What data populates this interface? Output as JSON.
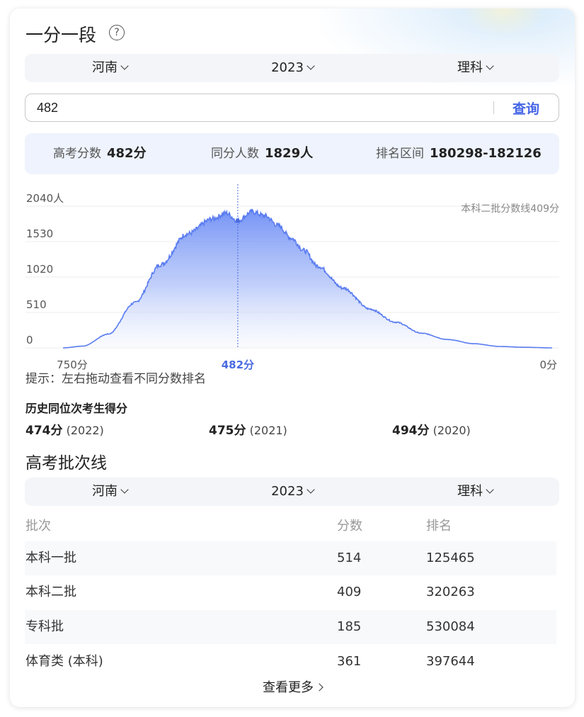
{
  "title": "一分一段",
  "help_icon": "question-circle-icon",
  "filters": {
    "province": "河南",
    "year": "2023",
    "subject": "理科"
  },
  "search": {
    "value": "482",
    "button_label": "查询"
  },
  "stats": {
    "score_label": "高考分数",
    "score_value": "482分",
    "same_label": "同分人数",
    "same_value": "1829人",
    "rank_label": "排名区间",
    "rank_value": "180298-182126"
  },
  "chart_data": {
    "type": "area",
    "y_ticks": [
      "2040人",
      "1530",
      "1020",
      "510",
      "0"
    ],
    "y_values": [
      2040,
      1530,
      1020,
      510,
      0
    ],
    "x_range": [
      750,
      0
    ],
    "x_left_label": "750分",
    "x_right_label": "0分",
    "selected_score": 482,
    "selected_label": "482分",
    "annotation": "本科二批分数线409分",
    "series_anchor_points": [
      [
        750,
        0
      ],
      [
        720,
        25
      ],
      [
        680,
        200
      ],
      [
        640,
        650
      ],
      [
        600,
        1200
      ],
      [
        560,
        1640
      ],
      [
        520,
        1860
      ],
      [
        500,
        1940
      ],
      [
        482,
        1829
      ],
      [
        460,
        1960
      ],
      [
        440,
        1900
      ],
      [
        420,
        1760
      ],
      [
        400,
        1580
      ],
      [
        380,
        1400
      ],
      [
        360,
        1180
      ],
      [
        320,
        860
      ],
      [
        280,
        560
      ],
      [
        240,
        370
      ],
      [
        200,
        210
      ],
      [
        160,
        120
      ],
      [
        120,
        60
      ],
      [
        80,
        20
      ],
      [
        40,
        8
      ],
      [
        0,
        0
      ]
    ]
  },
  "hint": "提示：左右拖动查看不同分数排名",
  "history": {
    "title": "历史同位次考生得分",
    "items": [
      {
        "score": "474分",
        "year": "(2022)"
      },
      {
        "score": "475分",
        "year": "(2021)"
      },
      {
        "score": "494分",
        "year": "(2020)"
      }
    ]
  },
  "batch": {
    "title": "高考批次线",
    "filters": {
      "province": "河南",
      "year": "2023",
      "subject": "理科"
    },
    "headers": [
      "批次",
      "分数",
      "排名"
    ],
    "rows": [
      {
        "name": "本科一批",
        "score": "514",
        "rank": "125465"
      },
      {
        "name": "本科二批",
        "score": "409",
        "rank": "320263"
      },
      {
        "name": "专科批",
        "score": "185",
        "rank": "530084"
      },
      {
        "name": "体育类 (本科)",
        "score": "361",
        "rank": "397644"
      }
    ],
    "more_label": "查看更多"
  }
}
